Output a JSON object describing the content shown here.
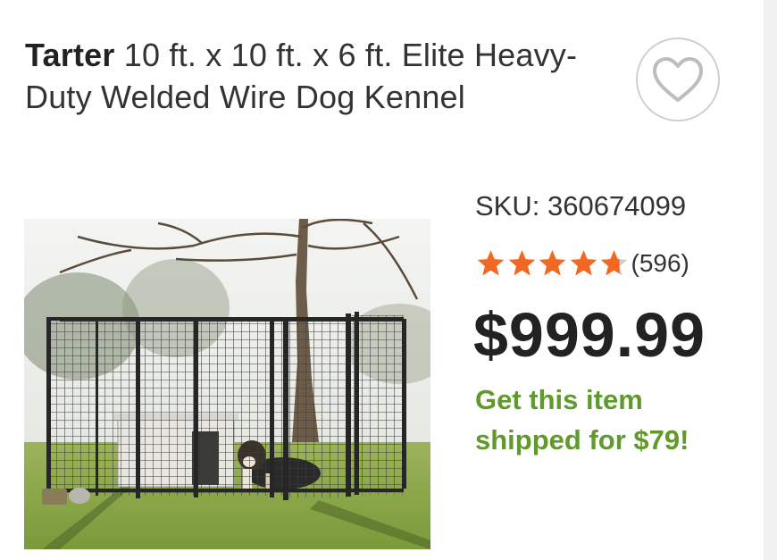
{
  "product": {
    "brand": "Tarter",
    "title_rest": " 10 ft. x 10 ft. x 6 ft. Elite Heavy-Duty Welded Wire Dog Kennel",
    "sku": "SKU: 360674099",
    "rating": {
      "stars": 4.7,
      "count": "(596)"
    },
    "price": "$999.99",
    "shipping_promo": "Get this item shipped for $79!"
  },
  "icons": {
    "favorite": "heart-icon",
    "star": "star-icon"
  },
  "colors": {
    "star": "#f26722",
    "star_empty": "#cccccc",
    "promo": "#5f9a2b",
    "price": "#222222"
  }
}
